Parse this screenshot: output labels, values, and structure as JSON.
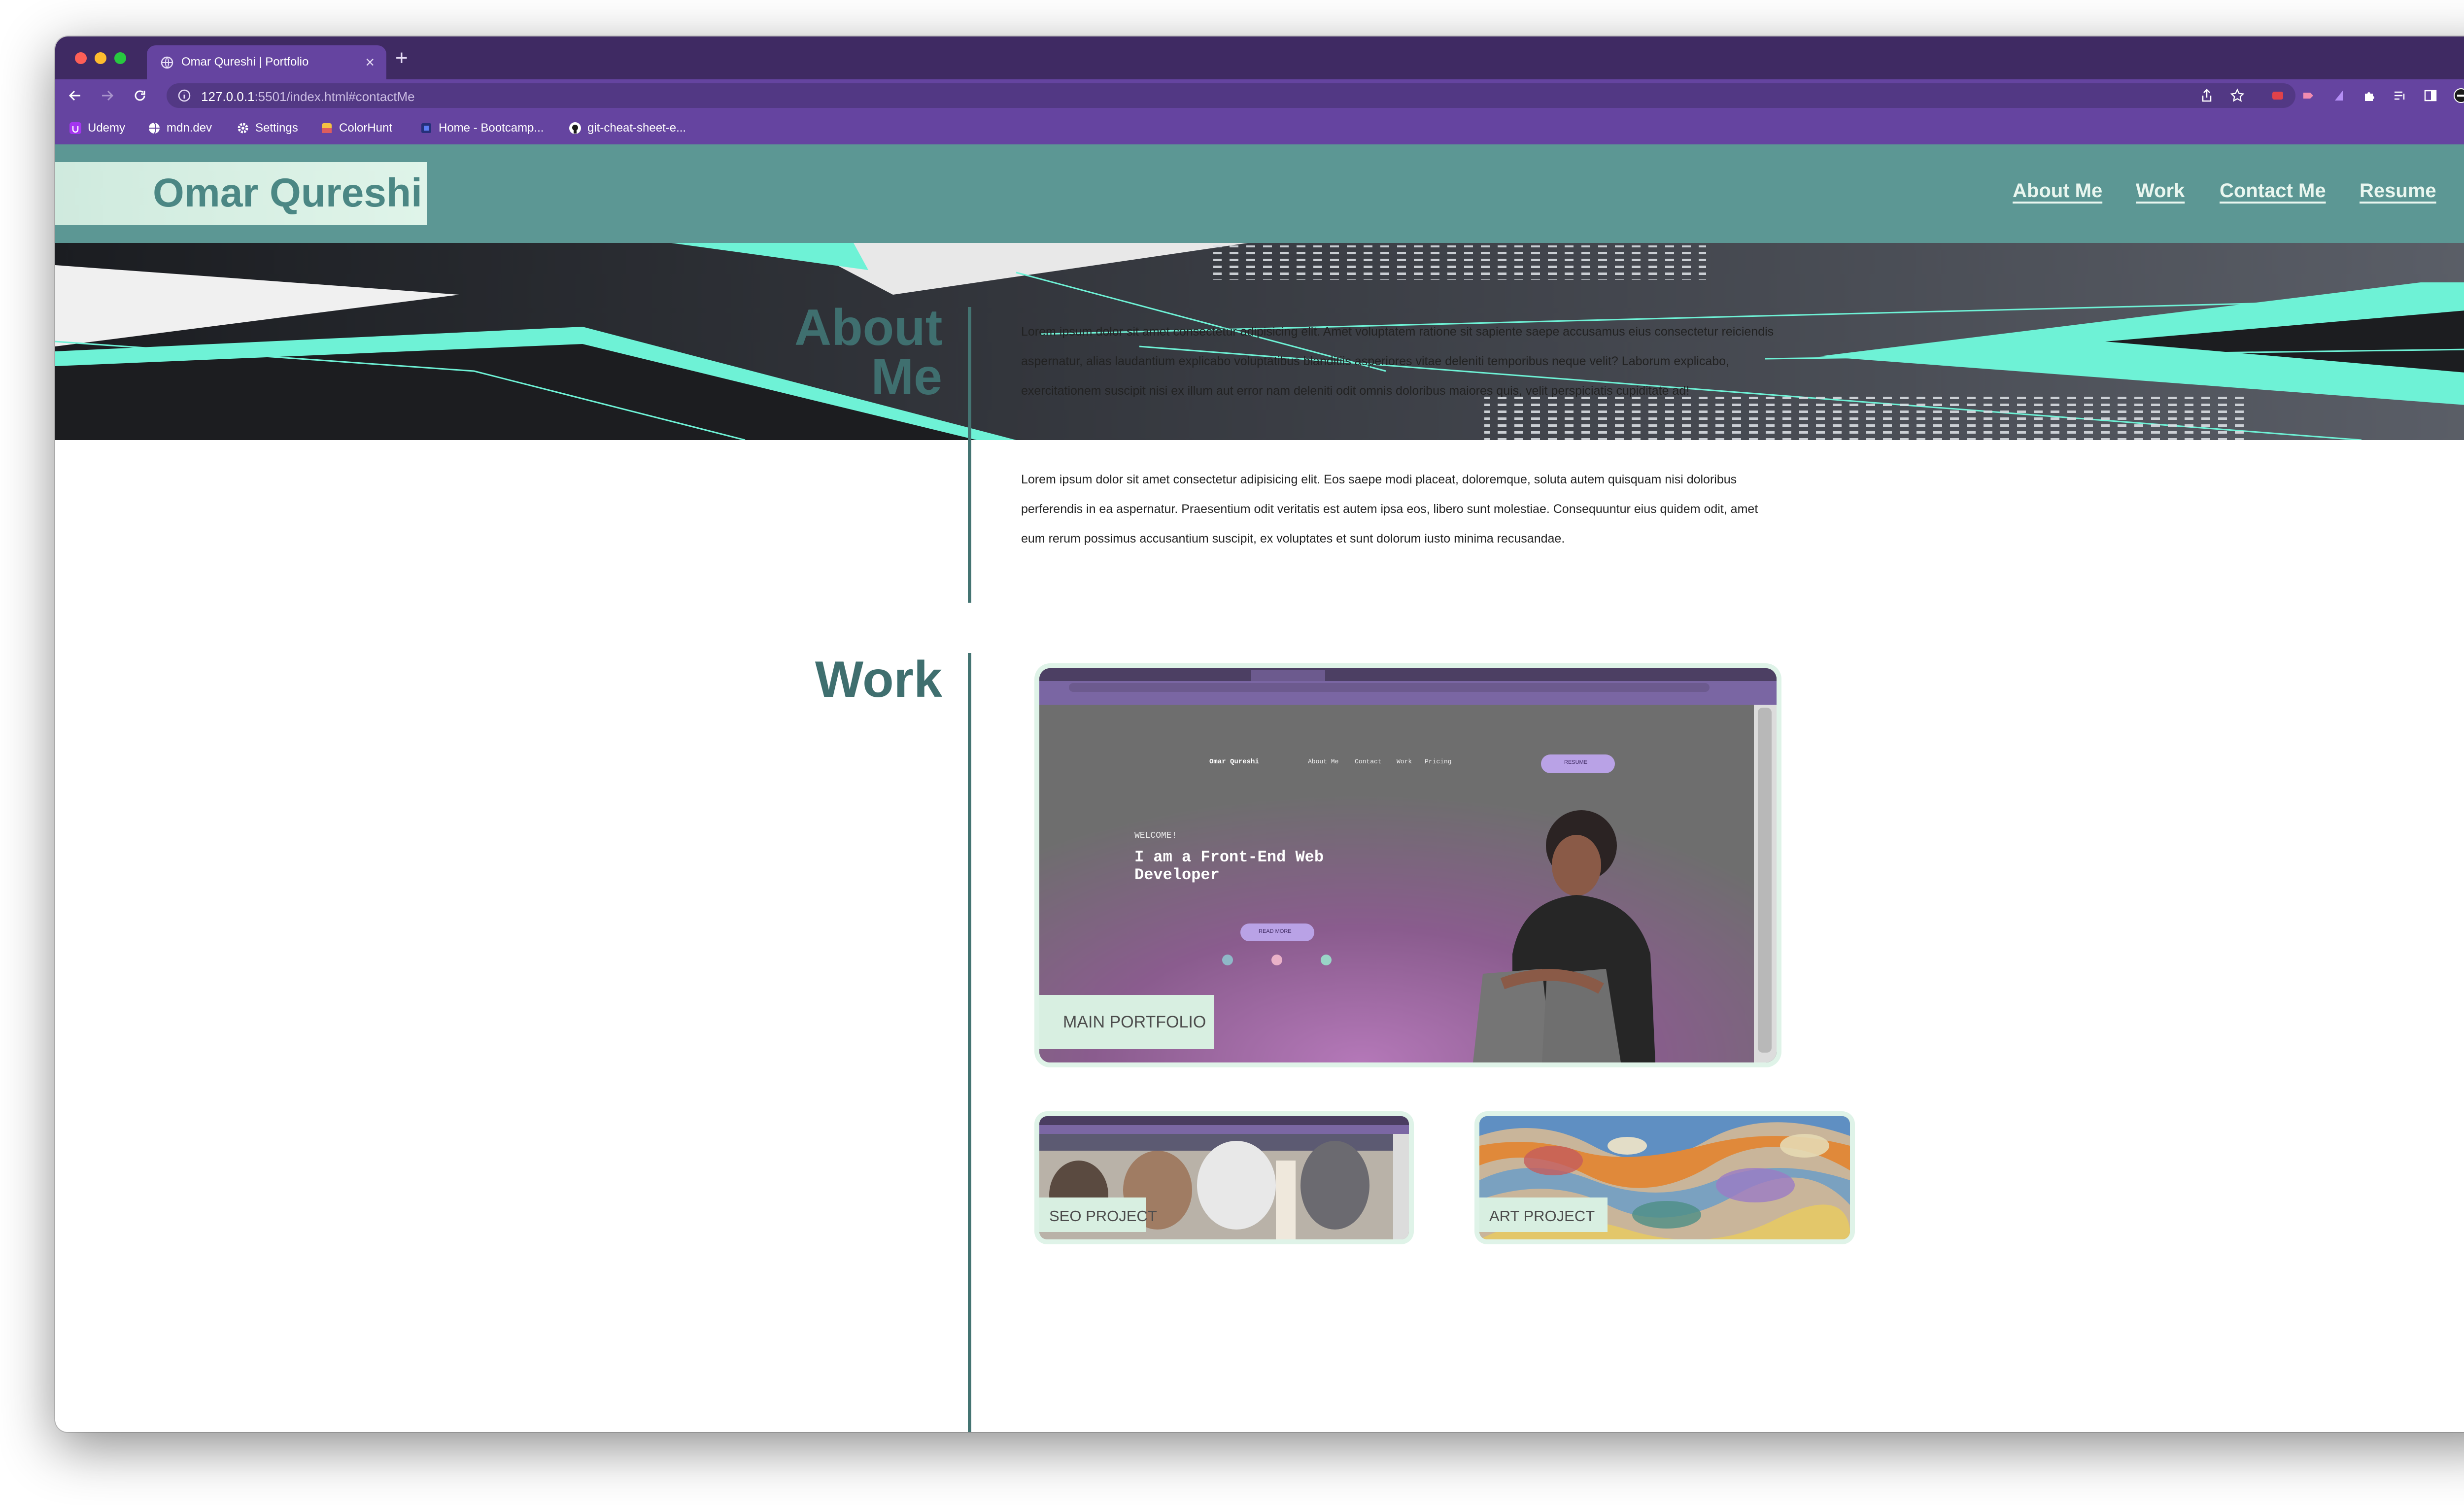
{
  "browser": {
    "tab_title": "Omar Qureshi | Portfolio",
    "tab_close": "×",
    "new_tab": "+",
    "url_host": "127.0.0.1",
    "url_rest": ":5501/index.html#contactMe",
    "bookmarks": [
      {
        "label": "Udemy",
        "icon": "udemy-icon"
      },
      {
        "label": "mdn.dev",
        "icon": "globe-icon"
      },
      {
        "label": "Settings",
        "icon": "gear-icon"
      },
      {
        "label": "ColorHunt",
        "icon": "colorhunt-icon"
      },
      {
        "label": "Home - Bootcamp...",
        "icon": "bootcamp-icon"
      },
      {
        "label": "git-cheat-sheet-e...",
        "icon": "github-icon"
      }
    ],
    "colors": {
      "tabbar": "#3f2a63",
      "toolbar": "#6544a0"
    }
  },
  "site": {
    "logo": "Omar Qureshi",
    "nav": [
      "About Me",
      "Work",
      "Contact Me",
      "Resume"
    ],
    "colors": {
      "header": "#5c9794",
      "accent": "#6ef2d6",
      "heading": "#3f6f6f"
    }
  },
  "about": {
    "title_line1": "About",
    "title_line2": "Me",
    "p1_lines": [
      "Lorem ipsum dolor sit amet consectetur adipisicing elit. Amet voluptatem ratione sit sapiente saepe accusamus eius consectetur reiciendis",
      "aspernatur, alias laudantium explicabo voluptatibus blanditiis asperiores vitae deleniti temporibus neque velit? Laborum explicabo,",
      "exercitationem suscipit nisi ex illum aut error nam deleniti odit omnis doloribus maiores quis, velit perspiciatis cupiditate ad!"
    ],
    "p2_lines": [
      "Lorem ipsum dolor sit amet consectetur adipisicing elit. Eos saepe modi placeat, doloremque, soluta autem quisquam nisi doloribus",
      "perferendis in ea aspernatur. Praesentium odit veritatis est autem ipsa eos, libero sunt molestiae. Consequuntur eius quidem odit, amet",
      "eum rerum possimus accusantium suscipit, ex voluptates et sunt dolorum iusto minima recusandae."
    ]
  },
  "work": {
    "title": "Work",
    "main_label": "MAIN PORTFOLIO",
    "seo_label": "SEO PROJECT",
    "art_label": "ART PROJECT",
    "preview": {
      "logo": "Omar Qureshi",
      "nav": [
        "About Me",
        "Contact",
        "Work",
        "Pricing"
      ],
      "resume_btn": "RESUME",
      "welcome": "WELCOME!",
      "headline_1": "I am a Front-End Web",
      "headline_2": "Developer",
      "read_more": "READ MORE"
    }
  }
}
